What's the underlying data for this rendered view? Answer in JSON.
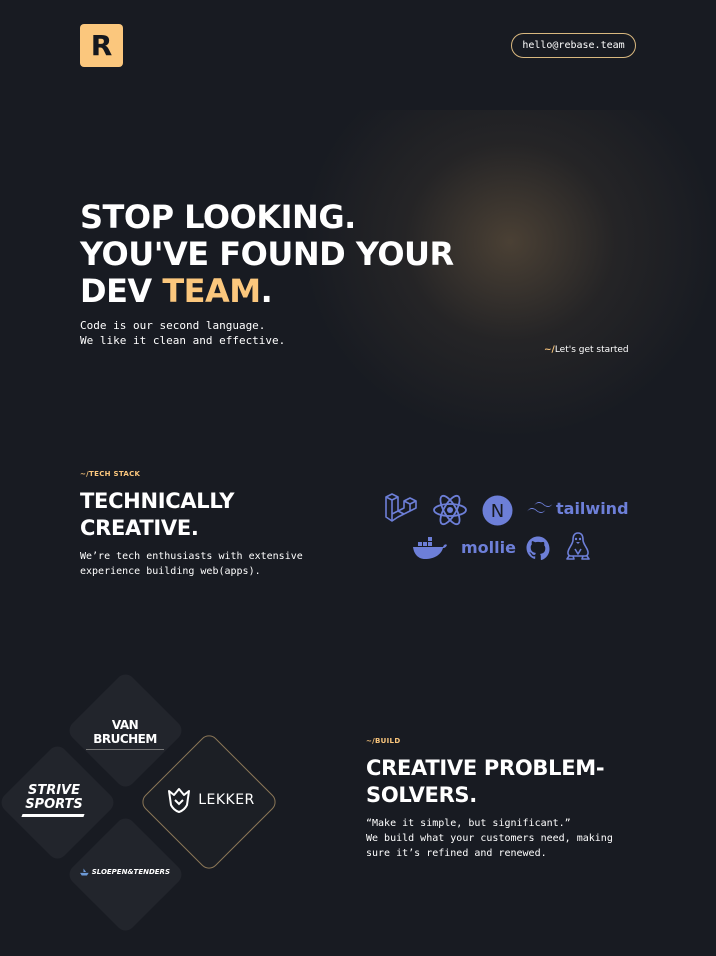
{
  "header": {
    "logo_letter": "R",
    "email": "hello@rebase.team"
  },
  "hero": {
    "title_line1": "STOP LOOKING.",
    "title_line2": "YOU'VE FOUND YOUR",
    "title_line3_prefix": "DEV ",
    "title_line3_accent": "TEAM",
    "title_line3_suffix": ".",
    "subtitle_line1": "Code is our second language.",
    "subtitle_line2": "We like it clean and effective.",
    "cta_prefix": "~/",
    "cta_label": "Let's get started"
  },
  "tech": {
    "kicker_prefix": "~/",
    "kicker": "TECH STACK",
    "title_line1": "TECHNICALLY",
    "title_line2": "CREATIVE.",
    "text_line1": "We’re tech enthusiasts with extensive",
    "text_line2": "experience building web(apps).",
    "icons": [
      "laravel-icon",
      "react-icon",
      "nextjs-icon",
      "tailwind-icon",
      "docker-icon",
      "mollie-icon",
      "github-icon",
      "linux-icon"
    ],
    "tailwind_label": "tailwind",
    "mollie_label": "mollie",
    "next_letter": "N",
    "icon_color": "#6d7fd8"
  },
  "build": {
    "kicker_prefix": "~/",
    "kicker": "BUILD",
    "title_line1": "CREATIVE PROBLEM-",
    "title_line2": "SOLVERS.",
    "text_line1": "“Make it simple, but significant.”",
    "text_line2": "We build what your customers need, making",
    "text_line3": "sure it’s refined and renewed."
  },
  "clients": {
    "van_bruchem": "VAN BRUCHEM",
    "strive_line1": "STRIVE",
    "strive_line2": "SPORTS",
    "lekker": "LEKKER",
    "sloepen": "SLOEPEN&TENDERS"
  },
  "colors": {
    "background": "#181b22",
    "accent": "#fbc77d",
    "icon": "#6d7fd8"
  }
}
